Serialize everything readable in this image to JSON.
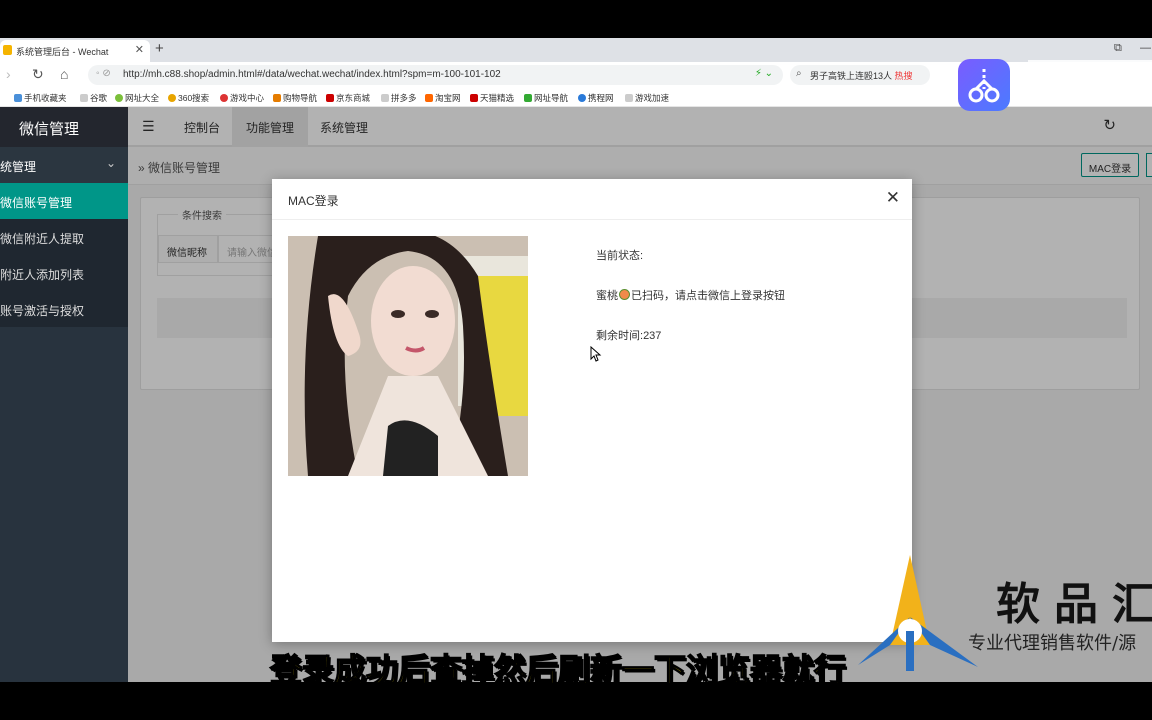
{
  "browser": {
    "tab_title": "系统管理后台 - Wechat",
    "new_tab": "+",
    "url_prefix": "不安全",
    "url": "http://mh.c88.shop/admin.html#/data/wechat.wechat/index.html?spm=m-100-101-102",
    "search_text": "男子高铁上连殴13人",
    "search_hot": "热搜",
    "bookmarks": [
      "手机收藏夹",
      "谷歌",
      "网址大全",
      "360搜索",
      "游戏中心",
      "购物导航",
      "京东商城",
      "拼多多",
      "淘宝网",
      "天猫精选",
      "网址导航",
      "携程网",
      "游戏加速"
    ]
  },
  "sidebar": {
    "title": "微信管理",
    "menu": "统管理",
    "items": [
      {
        "label": "微信账号管理",
        "active": true
      },
      {
        "label": "微信附近人提取",
        "active": false
      },
      {
        "label": "附近人添加列表",
        "active": false
      },
      {
        "label": "账号激活与授权",
        "active": false
      }
    ]
  },
  "topnav": {
    "links": [
      "控制台",
      "功能管理",
      "系统管理"
    ],
    "active_index": 1
  },
  "breadcrumb": "微信账号管理",
  "toolbar": {
    "mac_login_label": "MAC登录"
  },
  "search_panel": {
    "legend": "条件搜索",
    "field_label": "微信昵称",
    "field_placeholder": "请输入微信昵称"
  },
  "modal": {
    "title": "MAC登录",
    "status_label": "当前状态:",
    "status_name": "蜜桃",
    "status_text": "已扫码，请点击微信上登录按钮",
    "time_label": "剩余时间:",
    "time_value": "237"
  },
  "watermark": {
    "brand": "软品汇",
    "tagline": "专业代理销售软件/源"
  },
  "subtitle": "登录成功后查掉然后刷新一下浏览器就行",
  "colors": {
    "accent": "#009688",
    "sidebar": "#28333e",
    "subtitle": "#f9e000"
  }
}
